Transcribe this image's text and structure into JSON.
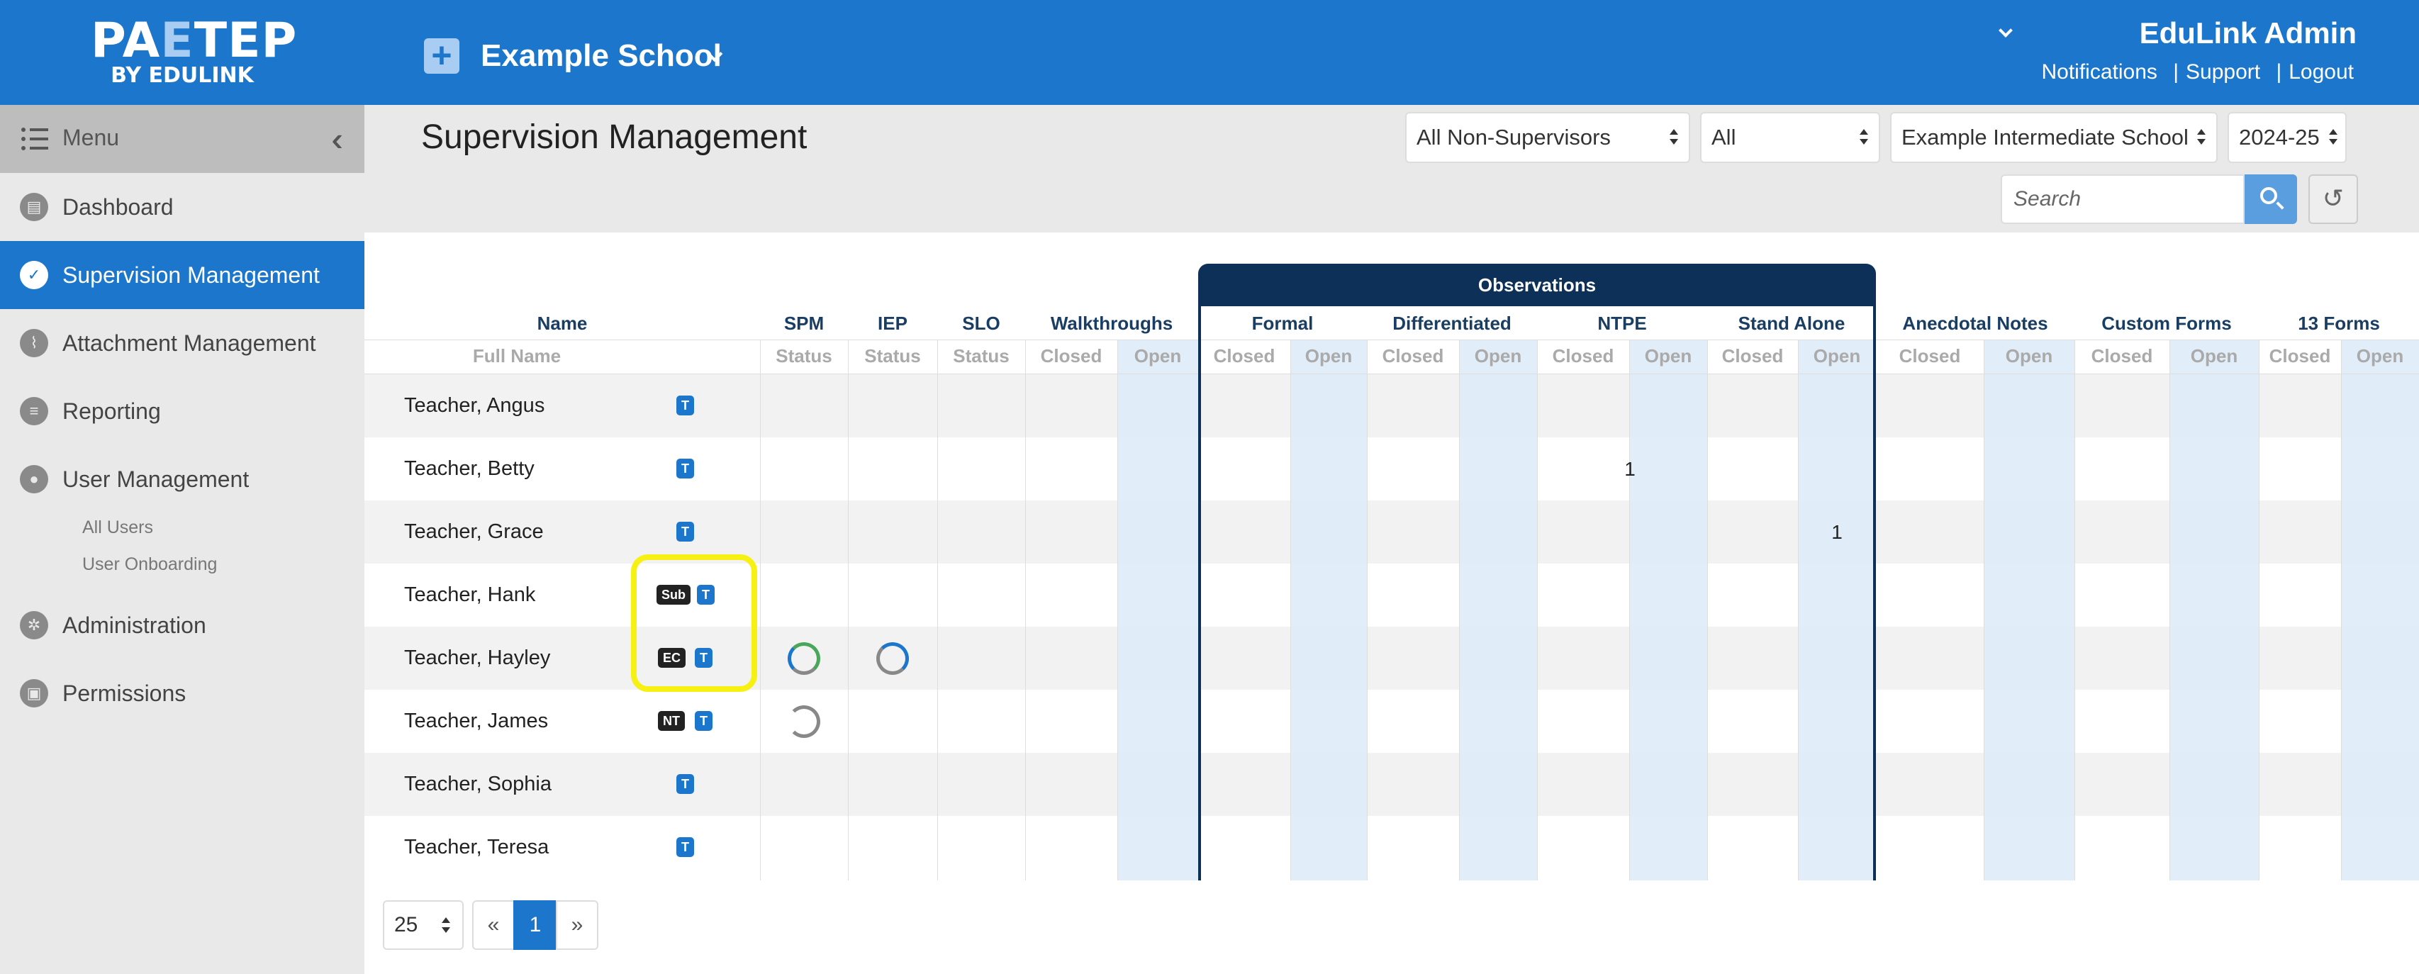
{
  "brand": {
    "logo_main_a": "PA",
    "logo_main_b": "E",
    "logo_main_c": "TEP",
    "logo_sub": "BY EDULINK",
    "primary_color": "#1b76cc",
    "dark_color": "#0c3057"
  },
  "header": {
    "school_name": "Example School",
    "user_name": "EduLink Admin",
    "links": [
      "Notifications",
      "Support",
      "Logout"
    ],
    "separator": "|"
  },
  "sidebar": {
    "menu_label": "Menu",
    "items": [
      {
        "label": "Dashboard",
        "icon": "dashboard-icon"
      },
      {
        "label": "Supervision Management",
        "icon": "check-circle-icon",
        "active": true
      },
      {
        "label": "Attachment Management",
        "icon": "paperclip-icon"
      },
      {
        "label": "Reporting",
        "icon": "bar-chart-icon"
      },
      {
        "label": "User Management",
        "icon": "user-icon"
      },
      {
        "label": "Administration",
        "icon": "gear-icon"
      },
      {
        "label": "Permissions",
        "icon": "lock-icon"
      }
    ],
    "sub_items": [
      "All Users",
      "User Onboarding"
    ]
  },
  "content": {
    "title": "Supervision Management",
    "filters": [
      "All Non-Supervisors",
      "All",
      "Example Intermediate School",
      "2024-25"
    ],
    "search_placeholder": "Search"
  },
  "table": {
    "group_header": "Observations",
    "columns": [
      "Name",
      "SPM",
      "IEP",
      "SLO",
      "Walkthroughs",
      "Formal",
      "Differentiated",
      "NTPE",
      "Stand Alone",
      "Anecdotal Notes",
      "Custom Forms",
      "13 Forms"
    ],
    "subheaders": {
      "name": "Full Name",
      "status": "Status",
      "closed": "Closed",
      "open": "Open"
    },
    "rows": [
      {
        "name": "Teacher, Angus",
        "badges": [
          "T"
        ]
      },
      {
        "name": "Teacher, Betty",
        "badges": [
          "T"
        ],
        "ntpe_open": "1"
      },
      {
        "name": "Teacher, Grace",
        "badges": [
          "T"
        ],
        "standalone_open": "1"
      },
      {
        "name": "Teacher, Hank",
        "badges": [
          "Sub",
          "T"
        ]
      },
      {
        "name": "Teacher, Hayley",
        "badges": [
          "EC",
          "T"
        ],
        "spm": "in-progress",
        "iep": "in-progress"
      },
      {
        "name": "Teacher, James",
        "badges": [
          "NT",
          "T"
        ],
        "spm": "not-started"
      },
      {
        "name": "Teacher, Sophia",
        "badges": [
          "T"
        ]
      },
      {
        "name": "Teacher, Teresa",
        "badges": [
          "T"
        ]
      }
    ]
  },
  "pagination": {
    "page_size": "25",
    "prev": "«",
    "current": "1",
    "next": "»"
  }
}
